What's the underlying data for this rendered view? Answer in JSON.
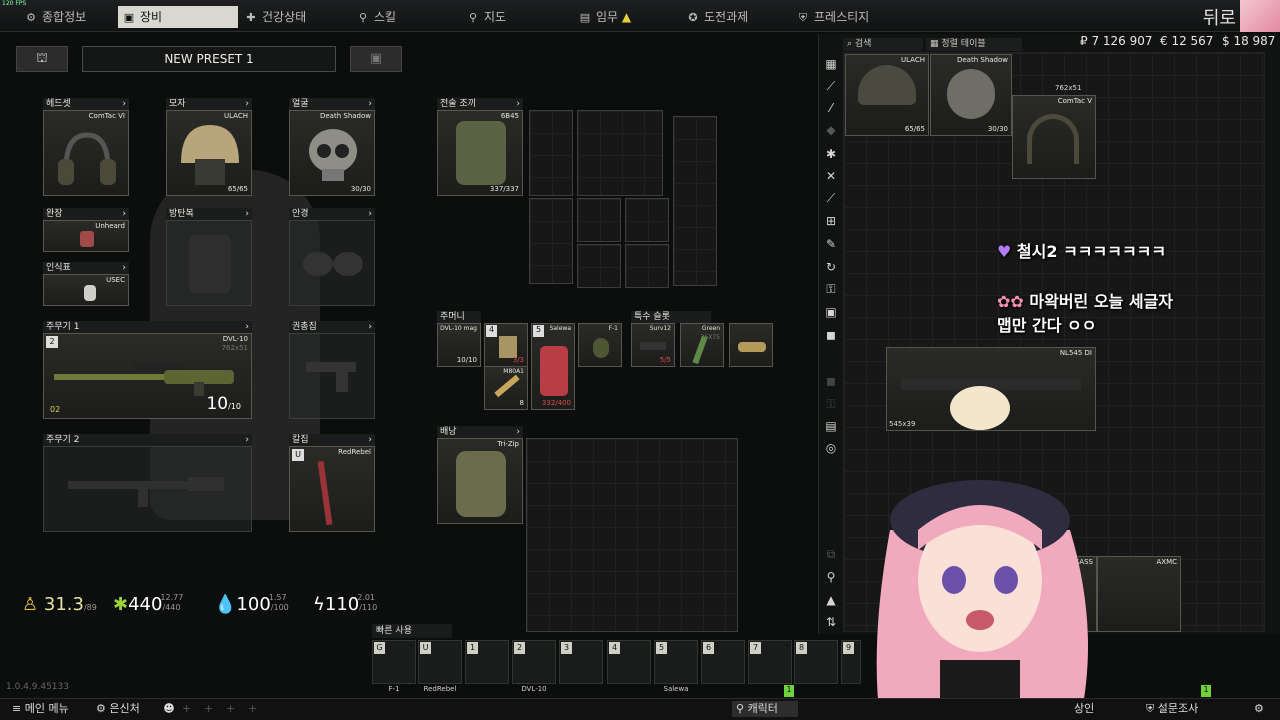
{
  "fps": "120 FPS",
  "nav": {
    "tabs": [
      "종합정보",
      "장비",
      "건강상태",
      "스킬",
      "지도",
      "임무",
      "도전과제",
      "프레스티지"
    ],
    "nickname": "뒤로"
  },
  "preset": {
    "name": "NEW PRESET 1"
  },
  "slots": {
    "headset": {
      "label": "헤드셋",
      "item": "ComTac VI"
    },
    "headwear": {
      "label": "모자",
      "item": "ULACH",
      "durability": "65/65"
    },
    "face": {
      "label": "얼굴",
      "item": "Death Shadow",
      "durability": "30/30"
    },
    "armband": {
      "label": "완장",
      "item": "Unheard"
    },
    "armor": {
      "label": "방탄복"
    },
    "eyewear": {
      "label": "안경"
    },
    "dogtag": {
      "label": "인식표",
      "item": "USEC"
    },
    "primary": {
      "label": "주무기 1",
      "item": "DVL-10",
      "caliber": "762x51",
      "ammo": "10",
      "ammo_max": "/10",
      "bind": "2",
      "mag_label": "02"
    },
    "holster": {
      "label": "권총집"
    },
    "secondary": {
      "label": "주무기 2"
    },
    "scabbard": {
      "label": "칼집",
      "item": "RedRebel",
      "bind": "U"
    },
    "rig": {
      "label": "전술 조끼",
      "item": "6B45",
      "durability": "337/337"
    },
    "pockets": {
      "label": "주머니",
      "items": [
        {
          "name": "DVL-10 mag",
          "count": "10/10"
        },
        {
          "name": "",
          "num": "4",
          "count": "3/3"
        },
        {
          "name": "M80A1",
          "count": "8"
        },
        {
          "name": "Salewa",
          "num": "5",
          "count": "332/400"
        },
        {
          "name": "F-1"
        }
      ]
    },
    "special": {
      "label": "특수 슬롯",
      "items": [
        {
          "name": "Surv12",
          "count": "5/5"
        },
        {
          "name": "Green",
          "sub": "26X75"
        },
        {
          "name": ""
        }
      ]
    },
    "backpack": {
      "label": "배낭",
      "item": "Tri-Zip"
    }
  },
  "stats": {
    "weight": {
      "value": "31.3",
      "unit": "KG",
      "max": "/89"
    },
    "energy": {
      "value": "440",
      "max": "/440",
      "delta": "12.77"
    },
    "hydration": {
      "value": "100",
      "max": "/100",
      "delta": "1.57"
    },
    "stamina": {
      "value": "110",
      "max": "/110",
      "delta": "2.01"
    }
  },
  "quick": {
    "title": "빠른 사용",
    "slots": [
      {
        "key": "G",
        "label": "F-1"
      },
      {
        "key": "U",
        "label": "RedRebel"
      },
      {
        "key": "1",
        "label": ""
      },
      {
        "key": "2",
        "label": "DVL-10"
      },
      {
        "key": "3",
        "label": ""
      },
      {
        "key": "4",
        "label": ""
      },
      {
        "key": "5",
        "label": "Salewa"
      },
      {
        "key": "6",
        "label": ""
      },
      {
        "key": "7",
        "label": ""
      },
      {
        "key": "8",
        "label": ""
      },
      {
        "key": "9",
        "label": ""
      }
    ]
  },
  "stash": {
    "search": "검색",
    "sort": "정렬 테이블",
    "currency": {
      "rub": "₽ 7 126 907",
      "eur": "€ 12 567",
      "usd": "$ 18 987"
    },
    "items": [
      {
        "name": "ULACH",
        "dur": "65/65"
      },
      {
        "name": "Death Shadow",
        "dur": "30/30"
      },
      {
        "name": "ComTac V",
        "cal": "762x51"
      },
      {
        "name": "NL545 DI",
        "cal": "545x39"
      },
      {
        "name": "RSASS"
      },
      {
        "name": "AXMC"
      }
    ]
  },
  "chat": [
    {
      "text": "철시2 ㅋㅋㅋㅋㅋㅋㅋ"
    },
    {
      "text": "마왁버린 오늘 세글자"
    },
    {
      "text": "맵만 간다 ㅇㅇ"
    }
  ],
  "version": "1.0.4.9.45133",
  "bottom": {
    "menu": "메인 메뉴",
    "hideout": "은신처",
    "character": "캐릭터",
    "traders": "상인",
    "survey": "설문조사",
    "badge": "1"
  }
}
